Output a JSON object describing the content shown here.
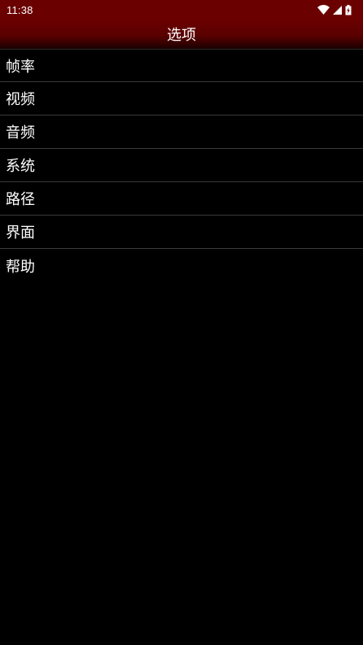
{
  "status_bar": {
    "time": "11:38",
    "icons": [
      "wifi-icon",
      "cell-signal-icon",
      "battery-charging-icon"
    ]
  },
  "app_bar": {
    "title": "选项"
  },
  "menu": {
    "items": [
      {
        "label": "帧率"
      },
      {
        "label": "视频"
      },
      {
        "label": "音频"
      },
      {
        "label": "系统"
      },
      {
        "label": "路径"
      },
      {
        "label": "界面"
      },
      {
        "label": "帮助"
      }
    ]
  },
  "colors": {
    "header": "#6b0000",
    "background": "#000000",
    "divider": "#3a3a3a",
    "text": "#ffffff"
  }
}
